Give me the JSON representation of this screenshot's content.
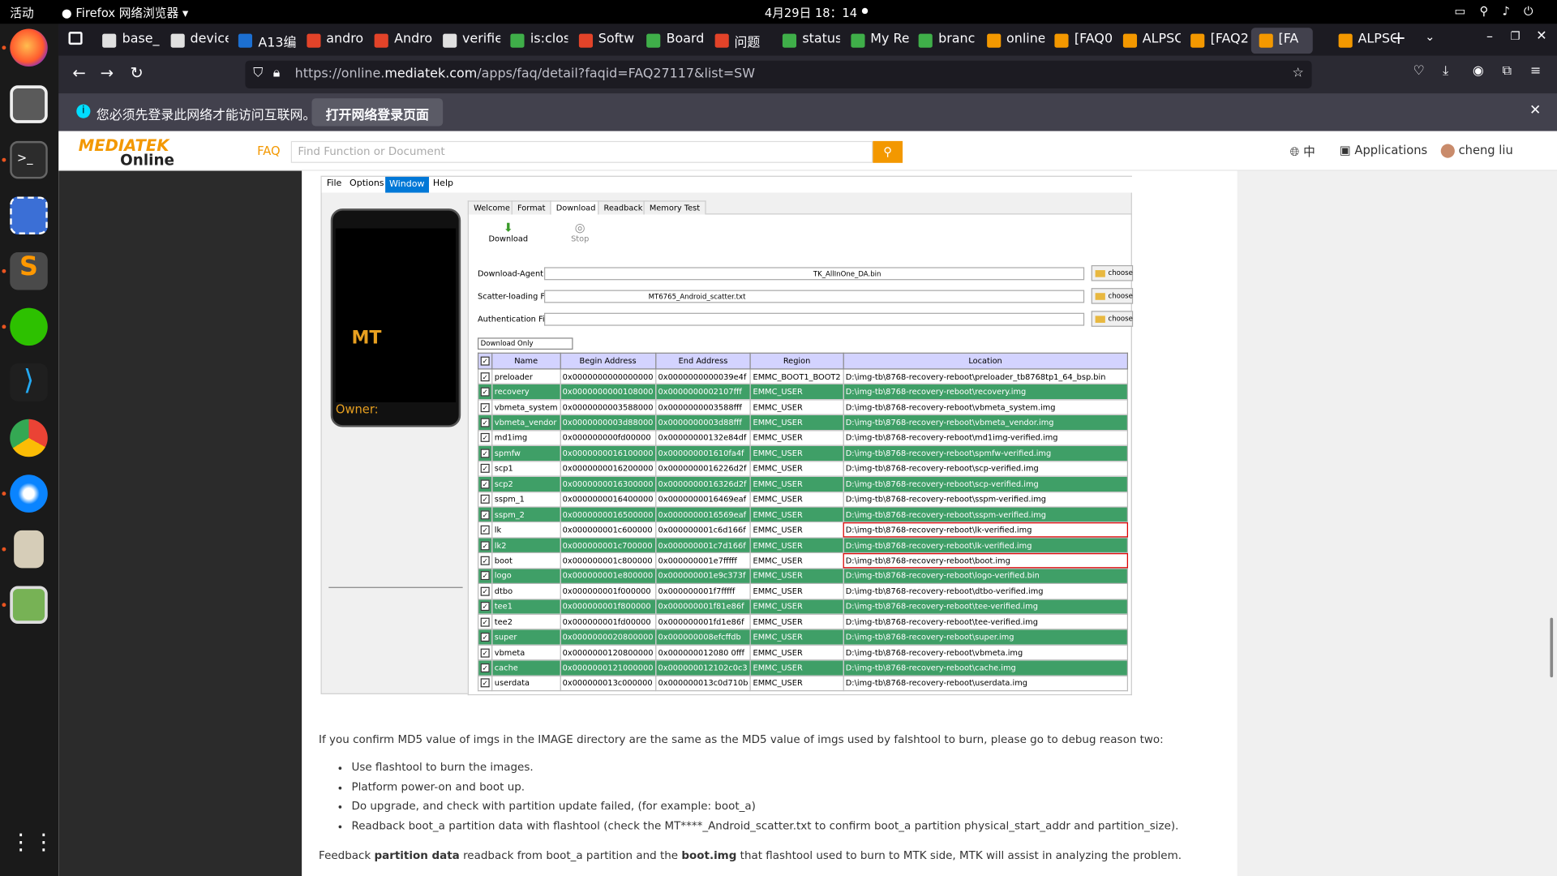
{
  "system": {
    "activities": "活动",
    "app_name": "Firefox 网络浏览器",
    "clock": "4月29日  18：14"
  },
  "tabs": [
    {
      "label": "base_",
      "color": "#e0e0e0"
    },
    {
      "label": "device",
      "color": "#e0e0e0"
    },
    {
      "label": "A13编",
      "color": "#1c6fd1"
    },
    {
      "label": "andro",
      "color": "#e24329"
    },
    {
      "label": "Andro",
      "color": "#e24329"
    },
    {
      "label": "verifie",
      "color": "#e0e0e0"
    },
    {
      "label": "is:clos",
      "color": "#3fae49"
    },
    {
      "label": "Softw",
      "color": "#e24329"
    },
    {
      "label": "Board",
      "color": "#3fae49"
    },
    {
      "label": "问题",
      "color": "#e24329"
    },
    {
      "label": "status",
      "color": "#3fae49"
    },
    {
      "label": "My Re",
      "color": "#3fae49"
    },
    {
      "label": "branc",
      "color": "#3fae49"
    },
    {
      "label": "online",
      "color": "#f39800"
    },
    {
      "label": "[FAQ0",
      "color": "#f39800"
    },
    {
      "label": "ALPSC",
      "color": "#f39800"
    },
    {
      "label": "[FAQ2",
      "color": "#f39800"
    },
    {
      "label": "[FA",
      "color": "#f39800"
    },
    {
      "label": "ALPSC",
      "color": "#f39800"
    }
  ],
  "url": {
    "prefix": "https://online.",
    "domain": "mediatek.com",
    "path": "/apps/faq/detail?faqid=FAQ27117&list=SW"
  },
  "notification": {
    "message": "您必须先登录此网络才能访问互联网。",
    "button": "打开网络登录页面"
  },
  "site": {
    "logo_top": "MEDIATEK",
    "logo_bottom": "Online",
    "faq": "FAQ",
    "search_placeholder": "Find Function or Document",
    "lang": "中",
    "applications": "Applications",
    "user": "cheng liu"
  },
  "flashtool": {
    "menu": [
      "File",
      "Options",
      "Window",
      "Help"
    ],
    "tabs": [
      "Welcome",
      "Format",
      "Download",
      "Readback",
      "Memory Test"
    ],
    "download_label": "Download",
    "stop_label": "Stop",
    "phone_brand": "MT",
    "phone_owner": "Owner:",
    "da_label": "Download-Agent",
    "da_value": "TK_AllInOne_DA.bin",
    "scatter_label": "Scatter-loading File",
    "scatter_value": "MT6765_Android_scatter.txt",
    "auth_label": "Authentication File",
    "choose": "choose",
    "mode": "Download Only",
    "headers": [
      "Name",
      "Begin Address",
      "End Address",
      "Region",
      "Location"
    ],
    "rows": [
      [
        "preloader",
        "0x0000000000000000",
        "0x0000000000039e4f",
        "EMMC_BOOT1_BOOT2",
        "D:\\img-tb\\8768-recovery-reboot\\preloader_tb8768tp1_64_bsp.bin"
      ],
      [
        "recovery",
        "0x0000000000108000",
        "0x0000000002107fff",
        "EMMC_USER",
        "D:\\img-tb\\8768-recovery-reboot\\recovery.img"
      ],
      [
        "vbmeta_system",
        "0x0000000003588000",
        "0x0000000003588fff",
        "EMMC_USER",
        "D:\\img-tb\\8768-recovery-reboot\\vbmeta_system.img"
      ],
      [
        "vbmeta_vendor",
        "0x0000000003d88000",
        "0x0000000003d88fff",
        "EMMC_USER",
        "D:\\img-tb\\8768-recovery-reboot\\vbmeta_vendor.img"
      ],
      [
        "md1img",
        "0x000000000fd00000",
        "0x00000000132e84df",
        "EMMC_USER",
        "D:\\img-tb\\8768-recovery-reboot\\md1img-verified.img"
      ],
      [
        "spmfw",
        "0x0000000016100000",
        "0x000000001610fa4f",
        "EMMC_USER",
        "D:\\img-tb\\8768-recovery-reboot\\spmfw-verified.img"
      ],
      [
        "scp1",
        "0x0000000016200000",
        "0x0000000016226d2f",
        "EMMC_USER",
        "D:\\img-tb\\8768-recovery-reboot\\scp-verified.img"
      ],
      [
        "scp2",
        "0x0000000016300000",
        "0x0000000016326d2f",
        "EMMC_USER",
        "D:\\img-tb\\8768-recovery-reboot\\scp-verified.img"
      ],
      [
        "sspm_1",
        "0x0000000016400000",
        "0x0000000016469eaf",
        "EMMC_USER",
        "D:\\img-tb\\8768-recovery-reboot\\sspm-verified.img"
      ],
      [
        "sspm_2",
        "0x0000000016500000",
        "0x0000000016569eaf",
        "EMMC_USER",
        "D:\\img-tb\\8768-recovery-reboot\\sspm-verified.img"
      ],
      [
        "lk",
        "0x000000001c600000",
        "0x000000001c6d166f",
        "EMMC_USER",
        "D:\\img-tb\\8768-recovery-reboot\\lk-verified.img"
      ],
      [
        "lk2",
        "0x000000001c700000",
        "0x000000001c7d166f",
        "EMMC_USER",
        "D:\\img-tb\\8768-recovery-reboot\\lk-verified.img"
      ],
      [
        "boot",
        "0x000000001c800000",
        "0x000000001e7fffff",
        "EMMC_USER",
        "D:\\img-tb\\8768-recovery-reboot\\boot.img"
      ],
      [
        "logo",
        "0x000000001e800000",
        "0x000000001e9c373f",
        "EMMC_USER",
        "D:\\img-tb\\8768-recovery-reboot\\logo-verified.bin"
      ],
      [
        "dtbo",
        "0x000000001f000000",
        "0x000000001f7fffff",
        "EMMC_USER",
        "D:\\img-tb\\8768-recovery-reboot\\dtbo-verified.img"
      ],
      [
        "tee1",
        "0x000000001f800000",
        "0x000000001f81e86f",
        "EMMC_USER",
        "D:\\img-tb\\8768-recovery-reboot\\tee-verified.img"
      ],
      [
        "tee2",
        "0x000000001fd00000",
        "0x000000001fd1e86f",
        "EMMC_USER",
        "D:\\img-tb\\8768-recovery-reboot\\tee-verified.img"
      ],
      [
        "super",
        "0x0000000020800000",
        "0x000000008efcffdb",
        "EMMC_USER",
        "D:\\img-tb\\8768-recovery-reboot\\super.img"
      ],
      [
        "vbmeta",
        "0x0000000120800000",
        "0x000000012080 0fff",
        "EMMC_USER",
        "D:\\img-tb\\8768-recovery-reboot\\vbmeta.img"
      ],
      [
        "cache",
        "0x0000000121000000",
        "0x000000012102c0c3",
        "EMMC_USER",
        "D:\\img-tb\\8768-recovery-reboot\\cache.img"
      ],
      [
        "userdata",
        "0x000000013c000000",
        "0x000000013c0d710b",
        "EMMC_USER",
        "D:\\img-tb\\8768-recovery-reboot\\userdata.img"
      ]
    ]
  },
  "article": {
    "intro": "If you confirm MD5 value of imgs in the IMAGE directory are the same as the MD5 value of imgs used by falshtool to burn, please go to debug reason two:",
    "bullets": [
      "Use flashtool to burn the images.",
      "Platform power-on and boot up.",
      "Do upgrade, and check with partition update failed, (for example: boot_a)",
      "Readback boot_a partition data with flashtool (check the MT****_Android_scatter.txt to confirm boot_a partition physical_start_addr and partition_size)."
    ],
    "feedback_a": "Feedback ",
    "feedback_b": "partition data",
    "feedback_c": " readback from boot_a partition and the ",
    "feedback_d": "boot.img",
    "feedback_e": " that flashtool used to burn to MTK side, MTK will assist in analyzing the problem."
  }
}
